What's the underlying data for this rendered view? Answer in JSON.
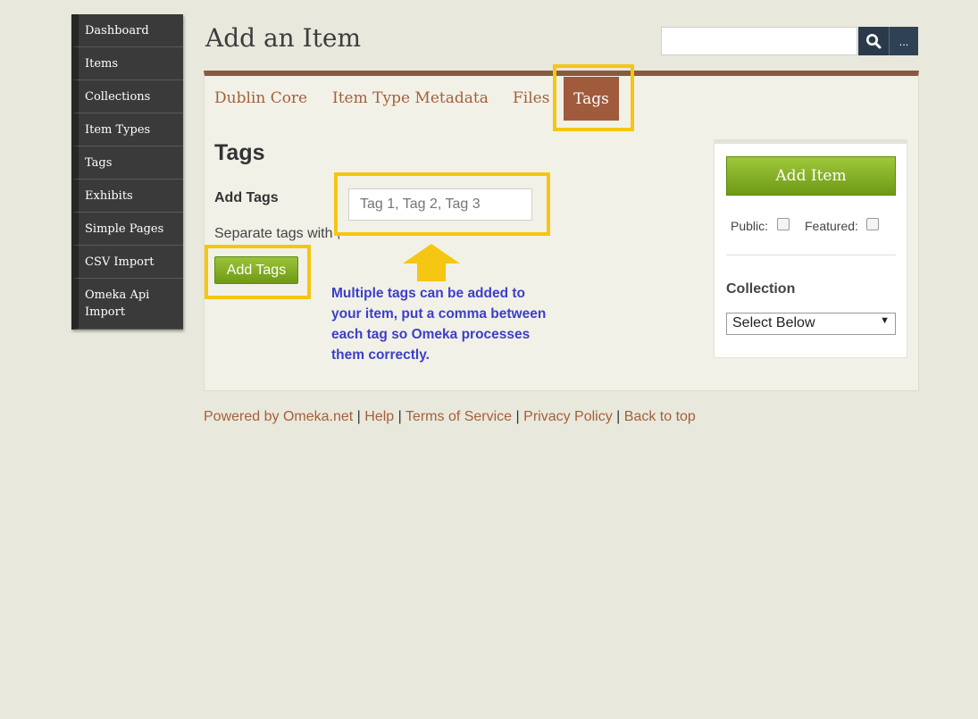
{
  "sidebar": {
    "items": [
      {
        "label": "Dashboard"
      },
      {
        "label": "Items"
      },
      {
        "label": "Collections"
      },
      {
        "label": "Item Types"
      },
      {
        "label": "Tags"
      },
      {
        "label": "Exhibits"
      },
      {
        "label": "Simple Pages"
      },
      {
        "label": "CSV Import"
      },
      {
        "label": "Omeka Api Import"
      }
    ]
  },
  "header": {
    "title": "Add an Item",
    "search_placeholder": "",
    "more_label": "..."
  },
  "tabs": [
    {
      "label": "Dublin Core"
    },
    {
      "label": "Item Type Metadata"
    },
    {
      "label": "Files"
    },
    {
      "label": "Tags",
      "active": true
    }
  ],
  "tags_section": {
    "title": "Tags",
    "add_label": "Add Tags",
    "input_placeholder": "Tag 1, Tag 2, Tag 3",
    "helper": "Separate tags with ,",
    "add_button": "Add Tags"
  },
  "annotation": {
    "note": "Multiple tags can be added to your item, put a comma between each tag so Omeka processes them correctly.",
    "highlight_color": "#f5c612",
    "note_color": "#3b3fc9"
  },
  "side_panel": {
    "add_item_button": "Add Item",
    "public_label": "Public:",
    "featured_label": "Featured:",
    "collection_label": "Collection",
    "collection_select": "Select Below"
  },
  "footer": {
    "links": [
      "Powered by Omeka.net",
      "Help",
      "Terms of Service",
      "Privacy Policy",
      "Back to top"
    ],
    "separator": "|"
  },
  "colors": {
    "accent": "#a4603a",
    "active_tab": "#a05a3c",
    "panel_border": "#8a5a40",
    "button_green": "#7aa51f",
    "sidebar": "#3a3a3a"
  }
}
